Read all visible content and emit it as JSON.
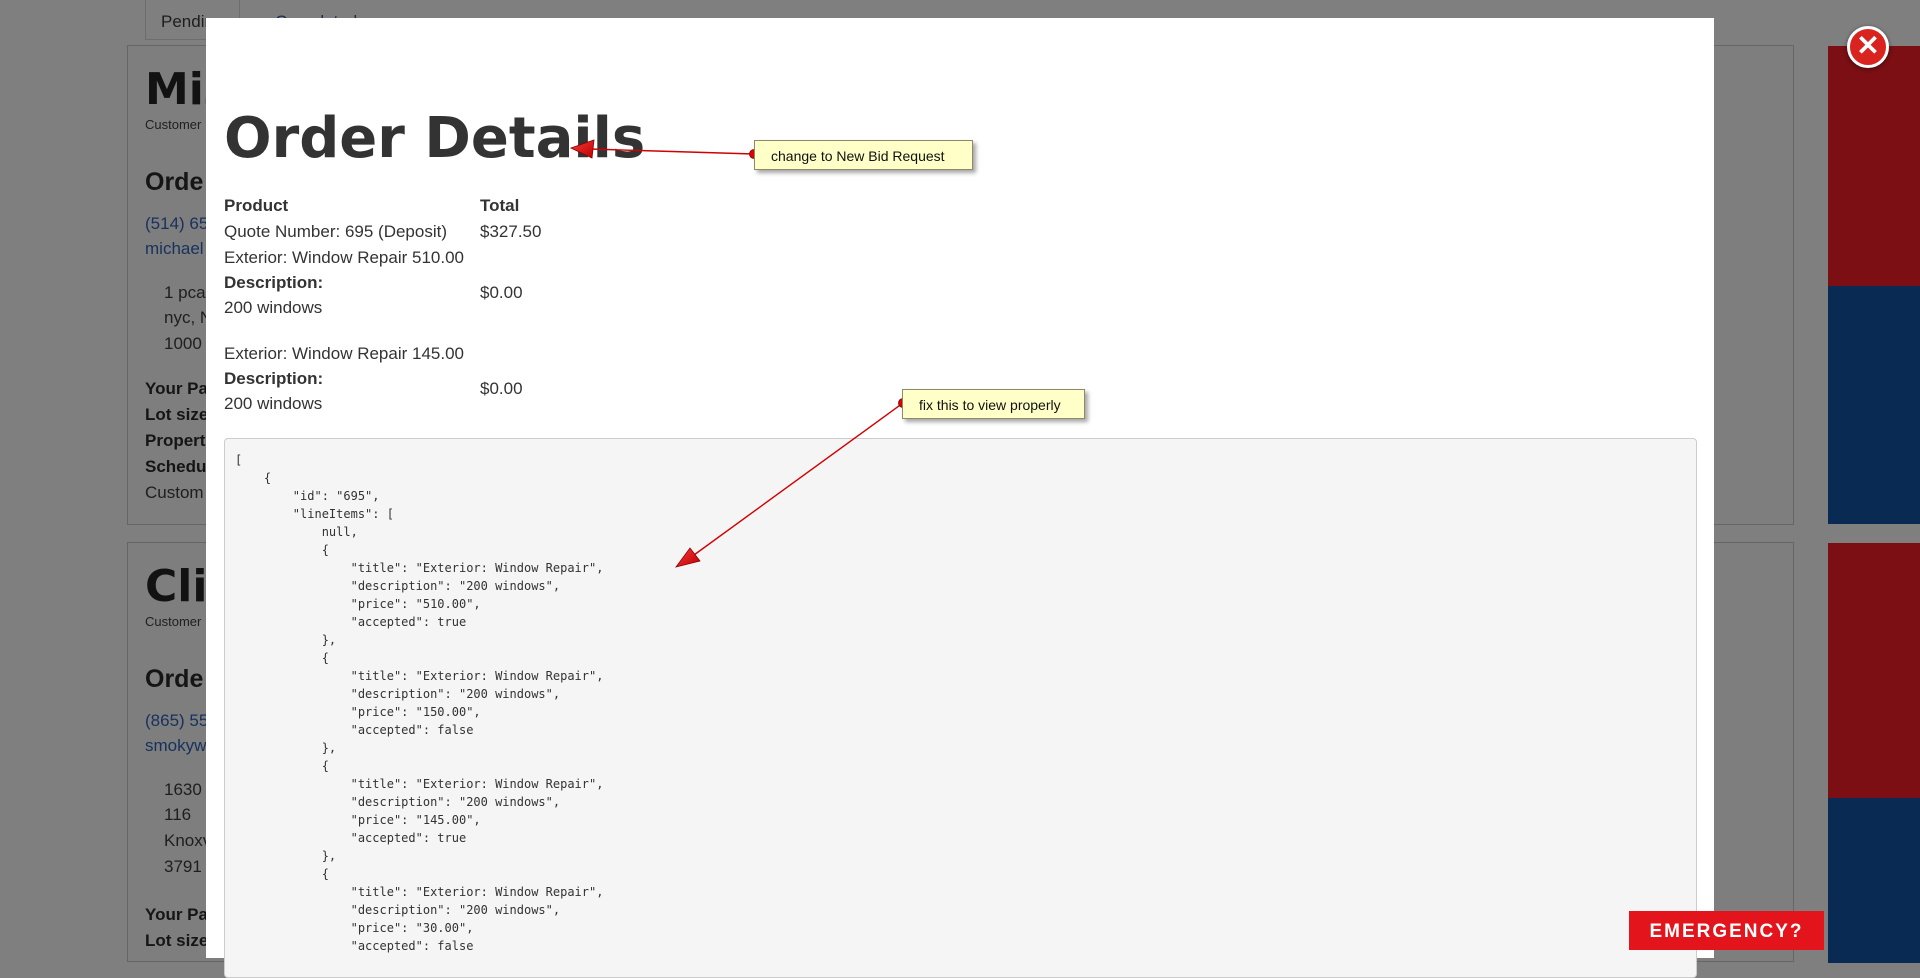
{
  "background": {
    "tabs": {
      "pending": "Pending",
      "completed": "Completed"
    },
    "card1": {
      "name_partial": "Miz",
      "customer_label_partial": "Customer",
      "order_heading_partial": "Orde",
      "phone_partial": "(514) 65",
      "email_partial": "michael",
      "address_lines": [
        "1 pca",
        "nyc, N",
        "1000"
      ],
      "fields": [
        "Your Pa",
        "Lot size",
        "Propert",
        "Schedu"
      ],
      "footer_partial": "Custom"
    },
    "card2": {
      "name_partial": "Clie",
      "customer_label_partial": "Customer",
      "order_heading_partial": "Orde",
      "phone_partial": "(865) 55",
      "email_partial": "smokyw",
      "address_lines": [
        "1630",
        "116",
        "Knoxv",
        "3791"
      ],
      "fields": [
        "Your Pa",
        "Lot size"
      ]
    }
  },
  "modal": {
    "title": "Order Details",
    "table": {
      "headers": {
        "product": "Product",
        "total": "Total"
      },
      "rows": [
        {
          "product": "Quote Number: 695 (Deposit)",
          "total": "$327.50"
        },
        {
          "product": "Exterior: Window Repair 510.00"
        },
        {
          "product_label": "Description:",
          "product": "200 windows",
          "total": "$0.00"
        },
        {
          "product": "Exterior: Window Repair 145.00"
        },
        {
          "product_label": "Description:",
          "product": "200 windows",
          "total": "$0.00"
        }
      ]
    },
    "json_dump": "[\n    {\n        \"id\": \"695\",\n        \"lineItems\": [\n            null,\n            {\n                \"title\": \"Exterior: Window Repair\",\n                \"description\": \"200 windows\",\n                \"price\": \"510.00\",\n                \"accepted\": true\n            },\n            {\n                \"title\": \"Exterior: Window Repair\",\n                \"description\": \"200 windows\",\n                \"price\": \"150.00\",\n                \"accepted\": false\n            },\n            {\n                \"title\": \"Exterior: Window Repair\",\n                \"description\": \"200 windows\",\n                \"price\": \"145.00\",\n                \"accepted\": true\n            },\n            {\n                \"title\": \"Exterior: Window Repair\",\n                \"description\": \"200 windows\",\n                \"price\": \"30.00\",\n                \"accepted\": false"
  },
  "annotations": {
    "note1": "change to New Bid Request",
    "note2": "fix this to view properly"
  },
  "controls": {
    "close_glyph": "✕",
    "emergency_label": "EMERGENCY?"
  },
  "colors": {
    "overlay": "#7f7f7f",
    "side_red": "#7b0f14",
    "side_blue": "#092a52",
    "emergency": "#e3141b",
    "close": "#d9231e",
    "note_bg": "#ffffc8"
  }
}
